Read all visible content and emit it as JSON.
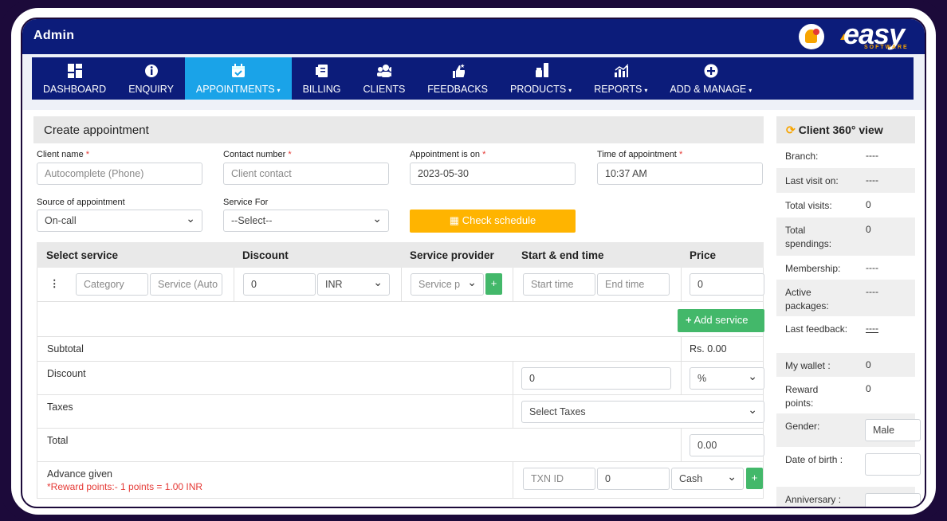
{
  "header": {
    "title": "Admin",
    "logo_text": "easy",
    "logo_sub": "SOFTWARE"
  },
  "nav": [
    {
      "label": "DASHBOARD",
      "icon": "dashboard-icon",
      "caret": ""
    },
    {
      "label": "ENQUIRY",
      "icon": "info-icon",
      "caret": ""
    },
    {
      "label": "APPOINTMENTS",
      "icon": "calendar-icon",
      "caret": "▾",
      "active": true
    },
    {
      "label": "BILLING",
      "icon": "billing-icon",
      "caret": ""
    },
    {
      "label": "CLIENTS",
      "icon": "clients-icon",
      "caret": ""
    },
    {
      "label": "FEEDBACKS",
      "icon": "feedback-icon",
      "caret": ""
    },
    {
      "label": "PRODUCTS",
      "icon": "products-icon",
      "caret": "▾"
    },
    {
      "label": "REPORTS",
      "icon": "reports-icon",
      "caret": "▾"
    },
    {
      "label": "ADD & MANAGE",
      "icon": "plus-circle-icon",
      "caret": "▾"
    }
  ],
  "form": {
    "title": "Create appointment",
    "client_name_label": "Client name",
    "client_name_placeholder": "Autocomplete (Phone)",
    "contact_label": "Contact number",
    "contact_placeholder": "Client contact",
    "appt_on_label": "Appointment is on",
    "appt_on_value": "2023-05-30",
    "time_label": "Time of appointment",
    "time_value": "10:37 AM",
    "source_label": "Source of appointment",
    "source_value": "On-call",
    "service_for_label": "Service For",
    "service_for_value": "--Select--",
    "check_schedule": "Check schedule",
    "required_mark": "*"
  },
  "table": {
    "headers": [
      "Select service",
      "Discount",
      "Service provider",
      "Start & end time",
      "Price"
    ],
    "row": {
      "category_placeholder": "Category",
      "service_placeholder": "Service (Auto",
      "discount_value": "0",
      "currency": "INR",
      "provider_placeholder": "Service p",
      "add_provider": "+",
      "start_placeholder": "Start time",
      "end_placeholder": "End time",
      "price_value": "0",
      "drag_handle": "⋮"
    },
    "add_service": "Add service",
    "subtotal_label": "Subtotal",
    "subtotal_value": "Rs. 0.00",
    "discount_label": "Discount",
    "discount_value": "0",
    "discount_type": "%",
    "taxes_label": "Taxes",
    "taxes_placeholder": "Select Taxes",
    "total_label": "Total",
    "total_value": "0.00",
    "advance_label": "Advance given",
    "reward_note": "*Reward points:- 1 points = 1.00 INR",
    "txn_placeholder": "TXN ID",
    "advance_value": "0",
    "payment_mode": "Cash",
    "add_payment": "+"
  },
  "client360": {
    "title": "Client 360° view",
    "rows": [
      {
        "k": "Branch:",
        "v": "----"
      },
      {
        "k": "Last visit on:",
        "v": "----"
      },
      {
        "k": "Total visits:",
        "v": "0"
      },
      {
        "k": "Total spendings:",
        "v": "0"
      },
      {
        "k": "Membership:",
        "v": "----"
      },
      {
        "k": "Active packages:",
        "v": "----"
      },
      {
        "k": "Last feedback:",
        "v": "----"
      },
      {
        "k": "My wallet :",
        "v": "0"
      },
      {
        "k": "Reward points:",
        "v": "0"
      }
    ],
    "gender_label": "Gender:",
    "gender_value": "Male",
    "dob_label": "Date of birth :",
    "anniversary_label": "Anniversary :"
  }
}
